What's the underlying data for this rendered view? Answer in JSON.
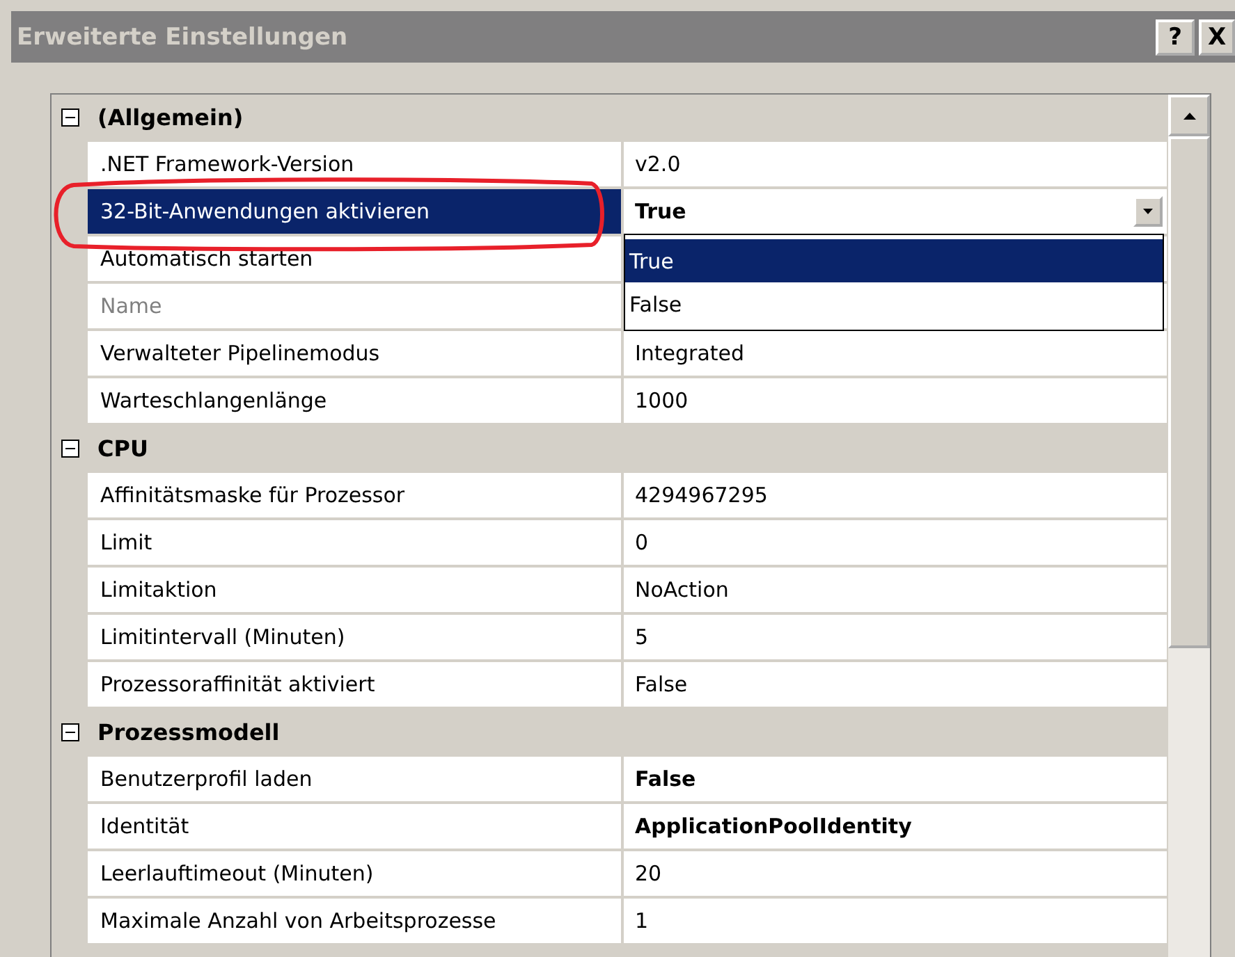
{
  "window": {
    "title": "Erweiterte Einstellungen",
    "buttons": [
      {
        "kind": "help",
        "label": "?"
      },
      {
        "kind": "close",
        "label": "X"
      }
    ]
  },
  "categories": [
    {
      "name": "(Allgemein)",
      "expanded": true,
      "properties": [
        {
          "name": ".NET Framework-Version",
          "value": "v2.0",
          "disabled": false,
          "selected": false
        },
        {
          "name": "32-Bit-Anwendungen aktivieren",
          "value": "True",
          "bold": true,
          "disabled": false,
          "selected": true,
          "annotated": true,
          "dropdown": {
            "options": [
              {
                "label": "True",
                "selected": true
              },
              {
                "label": "False",
                "selected": false
              }
            ]
          }
        },
        {
          "name": "Automatisch starten",
          "disabled": false,
          "selected": false
        },
        {
          "name": "Name",
          "disabled": true,
          "selected": false
        },
        {
          "name": "Verwalteter Pipelinemodus",
          "value": "Integrated",
          "disabled": false,
          "selected": false
        },
        {
          "name": "Warteschlangenlänge",
          "value": "1000",
          "disabled": false,
          "selected": false
        }
      ]
    },
    {
      "name": "CPU",
      "expanded": true,
      "properties": [
        {
          "name": "Affinitätsmaske für Prozessor",
          "value": "4294967295",
          "disabled": false,
          "selected": false
        },
        {
          "name": "Limit",
          "value": "0",
          "disabled": false,
          "selected": false
        },
        {
          "name": "Limitaktion",
          "value": "NoAction",
          "disabled": false,
          "selected": false
        },
        {
          "name": "Limitintervall (Minuten)",
          "value": "5",
          "disabled": false,
          "selected": false
        },
        {
          "name": "Prozessoraffinität aktiviert",
          "value": "False",
          "disabled": false,
          "selected": false
        }
      ]
    },
    {
      "name": "Prozessmodell",
      "expanded": true,
      "properties": [
        {
          "name": "Benutzerprofil laden",
          "value": "False",
          "bold": true,
          "disabled": false,
          "selected": false
        },
        {
          "name": "Identität",
          "value": "ApplicationPoolIdentity",
          "bold": true,
          "disabled": false,
          "selected": false
        },
        {
          "name": "Leerlauftimeout (Minuten)",
          "value": "20",
          "disabled": false,
          "selected": false
        },
        {
          "name": "Maximale Anzahl von Arbeitsprozesse",
          "value": "1",
          "disabled": false,
          "selected": false
        }
      ]
    }
  ]
}
